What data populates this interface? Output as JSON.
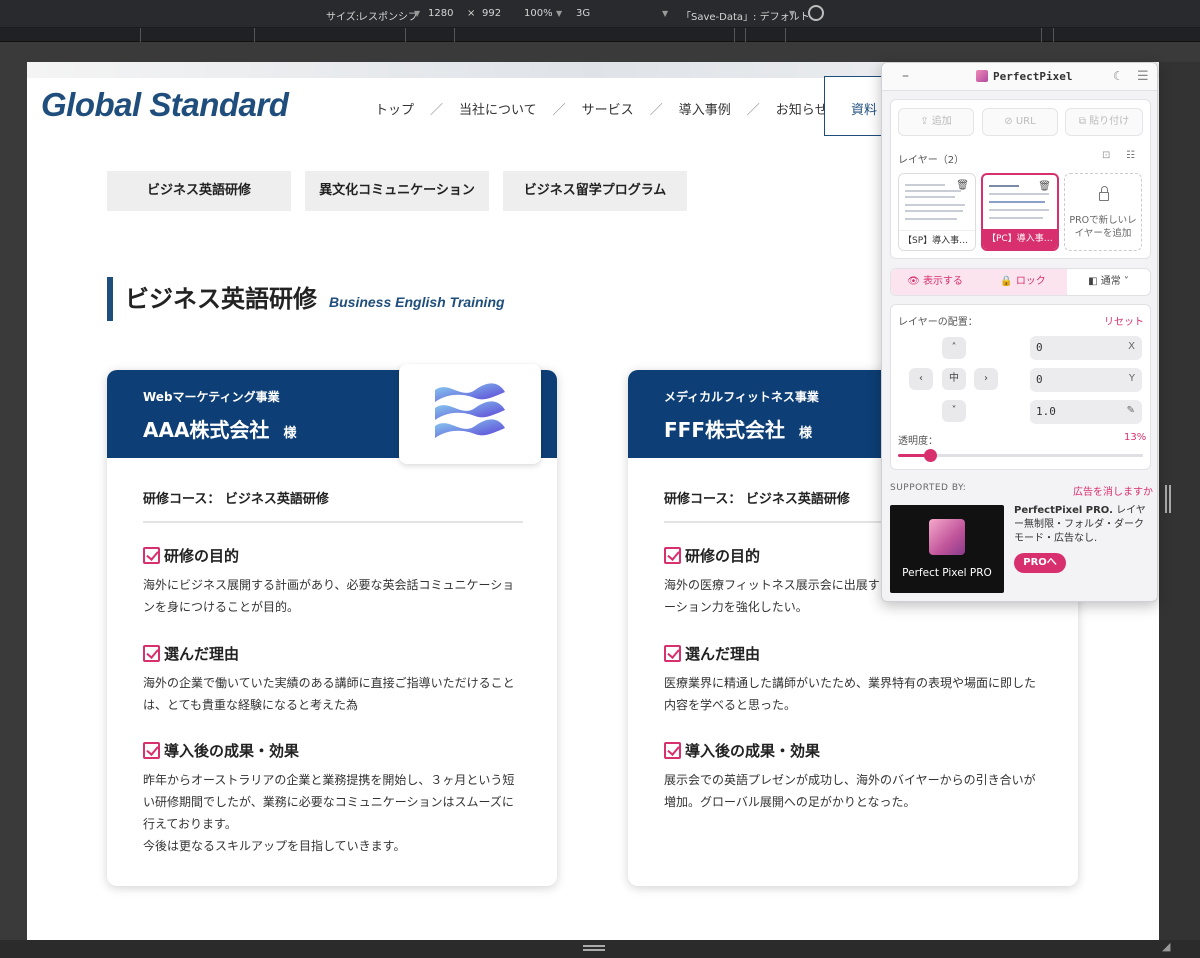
{
  "devtools": {
    "size_label": "サイズ:",
    "size_value": "レスポンシブ",
    "width": "1280",
    "times": "×",
    "height": "992",
    "zoom": "100%",
    "network": "3G",
    "save_data": "「Save-Data」: デフォルト"
  },
  "site": {
    "logo": "Global Standard",
    "nav": [
      "トップ",
      "当社について",
      "サービス",
      "導入事例",
      "お知らせ"
    ],
    "nav_separator": "／",
    "doc_button": "資料",
    "tabs": [
      "ビジネス英語研修",
      "異文化コミュニケーション",
      "ビジネス留学プログラム"
    ],
    "section_title": "ビジネス英語研修",
    "section_title_en": "Business English Training"
  },
  "cards": [
    {
      "business": "Webマーケティング事業",
      "company": "AAA株式会社",
      "honorific": "様",
      "course": "研修コース： ビジネス英語研修",
      "blocks": [
        {
          "heading": "研修の目的",
          "text": "海外にビジネス展開する計画があり、必要な英会話コミュニケーションを身につけることが目的。"
        },
        {
          "heading": "選んだ理由",
          "text": "海外の企業で働いていた実績のある講師に直接ご指導いただけることは、とても貴重な経験になると考えた為"
        },
        {
          "heading": "導入後の成果・効果",
          "text": "昨年からオーストラリアの企業と業務提携を開始し、３ヶ月という短い研修期間でしたが、業務に必要なコミュニケーションはスムーズに行えております。\n今後は更なるスキルアップを目指していきます。"
        }
      ]
    },
    {
      "business": "メディカルフィットネス事業",
      "company": "FFF株式会社",
      "honorific": "様",
      "course": "研修コース： ビジネス英語研修",
      "blocks": [
        {
          "heading": "研修の目的",
          "text": "海外の医療フィットネス展示会に出展するため、英語でのプレゼンテーション力を強化したい。"
        },
        {
          "heading": "選んだ理由",
          "text": "医療業界に精通した講師がいたため、業界特有の表現や場面に即した内容を学べると思った。"
        },
        {
          "heading": "導入後の成果・効果",
          "text": "展示会での英語プレゼンが成功し、海外のバイヤーからの引き合いが増加。グローバル展開への足がかりとなった。"
        }
      ]
    }
  ],
  "perfectpixel": {
    "title": "PerfectPixel",
    "add_label": "追加",
    "url_label": "URL",
    "paste_label": "貼り付け",
    "layers_label": "レイヤー（2）",
    "layer1_caption": "【SP】導入事…",
    "layer2_caption": "【PC】導入事…",
    "add_layer_pro": "PROで新しいレイヤーを追加",
    "show_label": "表示する",
    "lock_label": "ロック",
    "blend_label": "通常",
    "placement_label": "レイヤーの配置：",
    "reset_label": "リセット",
    "center_label": "中",
    "x_value": "0",
    "y_value": "0",
    "scale_value": "1.0",
    "x_axis": "X",
    "y_axis": "Y",
    "opacity_label": "透明度：",
    "opacity_value": "13%",
    "opacity_fraction": 0.13,
    "supported_by": "SUPPORTED BY:",
    "remove_ads": "広告を消しますか",
    "ad_caption": "Perfect Pixel PRO",
    "ad_title": "PerfectPixel PRO.",
    "ad_text": " レイヤー無制限・フォルダ・ダークモード・広告なし.",
    "pro_button": "PROへ",
    "colors": {
      "accent": "#d8306e",
      "navy": "#0d3e75"
    }
  }
}
